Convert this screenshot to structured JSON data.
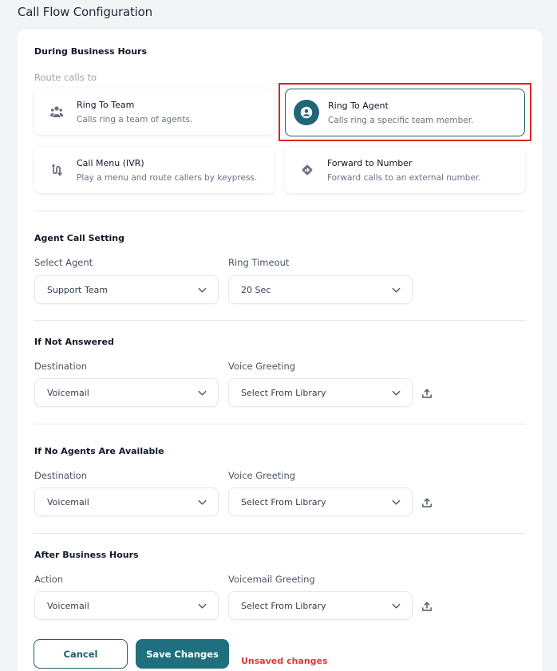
{
  "page_title": "Call Flow Configuration",
  "business_hours": {
    "title": "During Business Hours",
    "route_label": "Route calls to",
    "options": [
      {
        "title": "Ring To Team",
        "desc": "Calls ring a team of agents.",
        "icon": "team-icon"
      },
      {
        "title": "Ring To Agent",
        "desc": "Calls ring a specific team member.",
        "icon": "agent-icon",
        "selected": true
      },
      {
        "title": "Call Menu (IVR)",
        "desc": "Play a menu and route callers by keypress.",
        "icon": "ivr-icon"
      },
      {
        "title": "Forward to Number",
        "desc": "Forward calls to an external number.",
        "icon": "forward-icon"
      }
    ]
  },
  "agent_setting": {
    "title": "Agent Call Setting",
    "agent_label": "Select Agent",
    "agent_value": "Support Team",
    "timeout_label": "Ring Timeout",
    "timeout_value": "20 Sec"
  },
  "not_answered": {
    "title": "If Not Answered",
    "dest_label": "Destination",
    "dest_value": "Voicemail",
    "greeting_label": "Voice Greeting",
    "greeting_value": "Select From Library"
  },
  "no_agents": {
    "title": "If No Agents Are Available",
    "dest_label": "Destination",
    "dest_value": "Voicemail",
    "greeting_label": "Voice Greeting",
    "greeting_value": "Select From Library"
  },
  "after_hours": {
    "title": "After Business Hours",
    "action_label": "Action",
    "action_value": "Voicemail",
    "greeting_label": "Voicemail Greeting",
    "greeting_value": "Select From Library"
  },
  "actions": {
    "cancel_label": "Cancel",
    "save_label": "Save Changes",
    "unsaved_text": "Unsaved changes"
  },
  "colors": {
    "accent": "#1f6f7e",
    "highlight": "#d62828",
    "warning": "#dc3b3b"
  }
}
